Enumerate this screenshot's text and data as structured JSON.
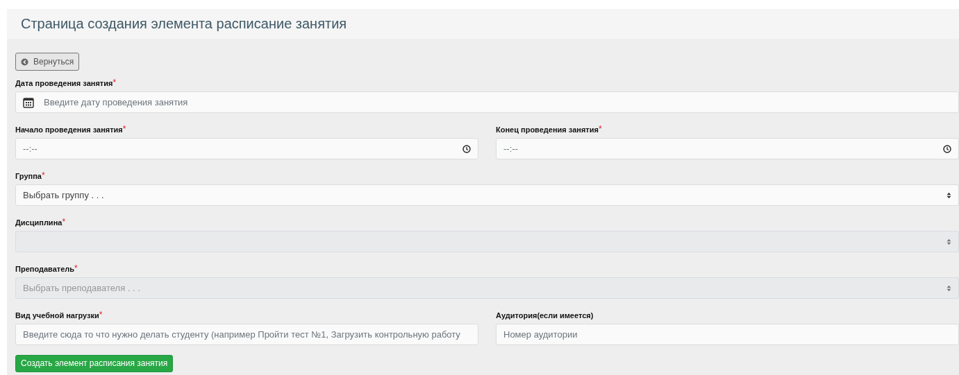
{
  "header": {
    "title": "Страница создания элемента расписание занятия"
  },
  "back_button": {
    "label": "Вернуться"
  },
  "rows": [
    [
      {
        "kind": "date",
        "label": "Дата проведения занятия",
        "required_mark": "*",
        "placeholder": "Введите дату проведения занятия",
        "disabled": false
      }
    ],
    [
      {
        "kind": "time",
        "label": "Начало проведения занятия",
        "required_mark": "*",
        "placeholder": "--:--",
        "disabled": false
      },
      {
        "kind": "time",
        "label": "Конец проведения занятия",
        "required_mark": "*",
        "placeholder": "--:--",
        "disabled": false
      }
    ],
    [
      {
        "kind": "select",
        "label": "Группа",
        "required_mark": "*",
        "placeholder": "Выбрать группу . . .",
        "disabled": false
      }
    ],
    [
      {
        "kind": "select",
        "label": "Дисциплина",
        "required_mark": "*",
        "disabled": true
      }
    ],
    [
      {
        "kind": "select",
        "label": "Преподаватель",
        "required_mark": "*",
        "placeholder": "Выбрать преподавателя . . .",
        "disabled": true
      }
    ],
    [
      {
        "kind": "text",
        "label": "Вид учебной нагрузки",
        "required_mark": "*",
        "placeholder": "Введите сюда то что нужно делать студенту (например Пройти тест №1, Загрузить контрольную работу",
        "disabled": false
      },
      {
        "kind": "text",
        "label": "Аудитория(если имеется)",
        "placeholder": "Номер аудитории",
        "disabled": false
      }
    ]
  ],
  "submit_button": {
    "label": "Создать элемент расписания занятия"
  }
}
